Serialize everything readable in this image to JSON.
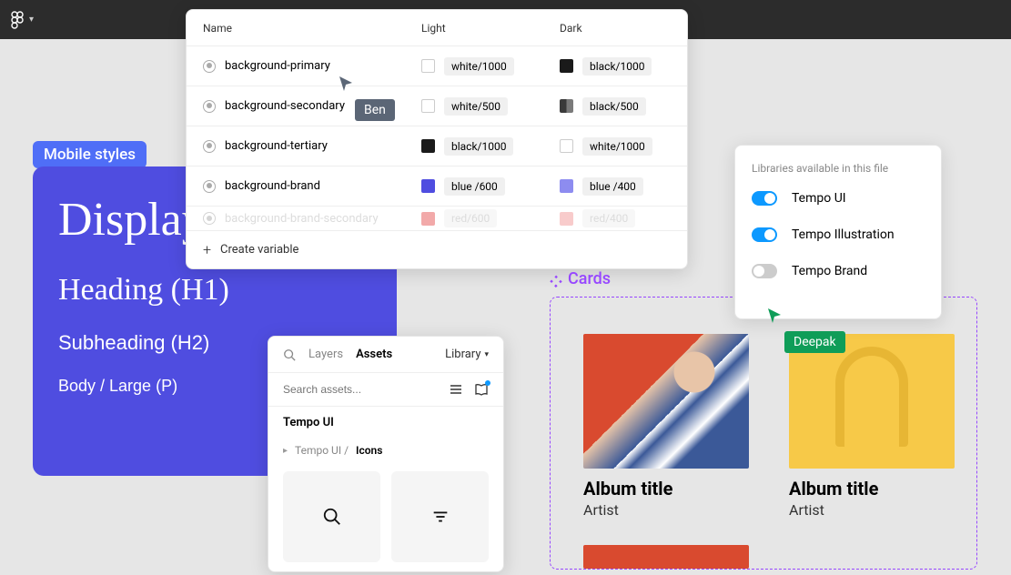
{
  "topbar": {
    "menu_icon": "figma"
  },
  "mobile_label": "Mobile styles",
  "styles": {
    "display": "Display",
    "heading": "Heading (H1)",
    "subheading": "Subheading (H2)",
    "body": "Body / Large (P)"
  },
  "variables": {
    "headers": {
      "name": "Name",
      "light": "Light",
      "dark": "Dark"
    },
    "rows": [
      {
        "name": "background-primary",
        "light": {
          "label": "white/1000",
          "hex": "#ffffff",
          "outline": true
        },
        "dark": {
          "label": "black/1000",
          "hex": "#1a1a1a"
        }
      },
      {
        "name": "background-secondary",
        "light": {
          "label": "white/500",
          "hex": "#ffffff",
          "outline": true
        },
        "dark": {
          "label": "black/500",
          "hex": "#3a3a3a"
        }
      },
      {
        "name": "background-tertiary",
        "light": {
          "label": "black/1000",
          "hex": "#1a1a1a"
        },
        "dark": {
          "label": "white/1000",
          "hex": "#ffffff",
          "outline": true
        }
      },
      {
        "name": "background-brand",
        "light": {
          "label": "blue /600",
          "hex": "#4f4de0"
        },
        "dark": {
          "label": "blue /400",
          "hex": "#8d8cf0"
        }
      },
      {
        "name": "background-brand-secondary",
        "light": {
          "label": "red/600",
          "hex": "#e34242"
        },
        "dark": {
          "label": "red/400",
          "hex": "#f08d8d"
        },
        "partial": true
      }
    ],
    "create_label": "Create variable"
  },
  "cursors": {
    "ben": "Ben",
    "deepak": "Deepak"
  },
  "assets": {
    "tabs": {
      "layers": "Layers",
      "assets": "Assets",
      "library": "Library"
    },
    "search_placeholder": "Search assets...",
    "lib_name": "Tempo UI",
    "breadcrumb": {
      "root": "Tempo UI /",
      "leaf": "Icons"
    }
  },
  "cards_label": "Cards",
  "cards": [
    {
      "title": "Album title",
      "artist": "Artist"
    },
    {
      "title": "Album title",
      "artist": "Artist"
    }
  ],
  "libraries": {
    "title": "Libraries available in this file",
    "items": [
      {
        "name": "Tempo UI",
        "on": true
      },
      {
        "name": "Tempo Illustration",
        "on": true
      },
      {
        "name": "Tempo Brand",
        "on": false
      }
    ]
  }
}
